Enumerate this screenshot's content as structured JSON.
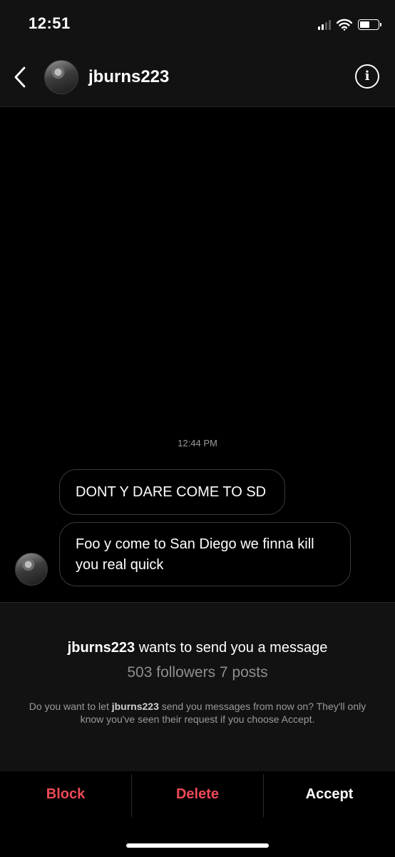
{
  "status_bar": {
    "time": "12:51"
  },
  "header": {
    "username": "jburns223"
  },
  "chat": {
    "timestamp": "12:44 PM",
    "messages": [
      {
        "text": "DONT Y DARE COME TO SD"
      },
      {
        "text": "Foo y come to San Diego we finna kill you real quick"
      }
    ]
  },
  "request": {
    "username": "jburns223",
    "title_suffix": "wants to send you a message",
    "stats": "503 followers 7 posts",
    "note_prefix": "Do you want to let",
    "note_username": "jburns223",
    "note_suffix": "send you messages from now on? They'll only know you've seen their request if you choose Accept."
  },
  "actions": {
    "block": "Block",
    "delete": "Delete",
    "accept": "Accept"
  },
  "colors": {
    "destructive": "#ed4956",
    "background": "#000000",
    "panel": "#121212"
  }
}
